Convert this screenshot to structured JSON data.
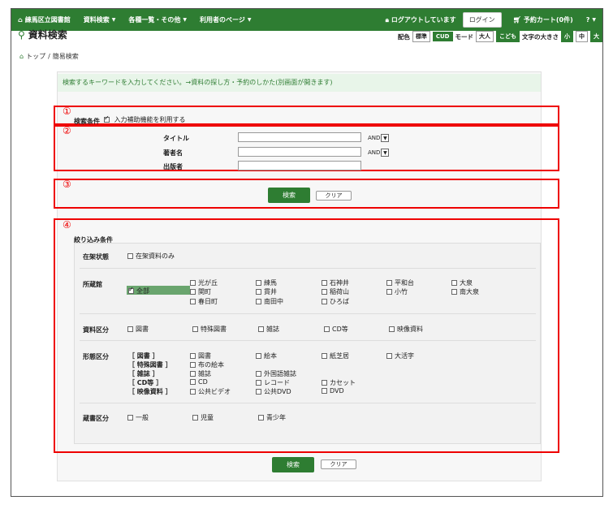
{
  "navbar": {
    "brand": "練馬区立図書館",
    "menu": [
      "資料検索",
      "各種一覧・その他",
      "利用者のページ"
    ],
    "logout_status": "ログアウトしています",
    "login": "ログイン",
    "cart": "予約カート(0件)",
    "help": "?"
  },
  "page": {
    "title": "資料検索",
    "display": {
      "color_label": "配色",
      "color_options": [
        "標準",
        "CUD"
      ],
      "mode_label": "モード",
      "mode_options": [
        "大人",
        "こども"
      ],
      "size_label": "文字の大きさ",
      "size_options": [
        "小",
        "中",
        "大"
      ]
    },
    "breadcrumb": [
      "トップ",
      "簡易検索"
    ]
  },
  "notice": "検索するキーワードを入力してください。→資料の探し方・予約のしかた(別画面が開きます)",
  "markers": [
    "①",
    "②",
    "③",
    "④"
  ],
  "search_conditions": {
    "label": "検索条件",
    "assist_label": "入力補助機能を利用する"
  },
  "fields": [
    {
      "label": "タイトル",
      "operator": "AND"
    },
    {
      "label": "著者名",
      "operator": "AND"
    },
    {
      "label": "出版者",
      "operator": ""
    }
  ],
  "buttons": {
    "search": "検索",
    "clear": "クリア"
  },
  "filters": {
    "title": "絞り込み条件",
    "availability": {
      "label": "在架状態",
      "option": "在架資料のみ"
    },
    "location": {
      "label": "所蔵館",
      "all": "全部",
      "branches": [
        [
          "光が丘",
          "練馬",
          "石神井",
          "平和台",
          "大泉"
        ],
        [
          "関町",
          "貫井",
          "稲荷山",
          "小竹",
          "南大泉"
        ],
        [
          "春日町",
          "南田中",
          "ひろば"
        ]
      ]
    },
    "material_type": {
      "label": "資料区分",
      "options": [
        "図書",
        "特殊図書",
        "雑誌",
        "CD等",
        "映像資料"
      ]
    },
    "format_type": {
      "label": "形態区分",
      "groups": [
        {
          "name": "［ 図書 ］",
          "options": [
            "図書",
            "絵本",
            "紙芝居",
            "大活字"
          ]
        },
        {
          "name": "［ 特殊図書 ］",
          "options": [
            "布の絵本"
          ]
        },
        {
          "name": "［ 雑誌 ］",
          "options": [
            "雑誌",
            "外国語雑誌"
          ]
        },
        {
          "name": "［ CD等 ］",
          "options": [
            "CD",
            "レコード",
            "カセット"
          ]
        },
        {
          "name": "［ 映像資料 ］",
          "options": [
            "公共ビデオ",
            "公共DVD",
            "DVD"
          ]
        }
      ]
    },
    "shelf_type": {
      "label": "蔵書区分",
      "options": [
        "一般",
        "児童",
        "青少年"
      ]
    }
  }
}
